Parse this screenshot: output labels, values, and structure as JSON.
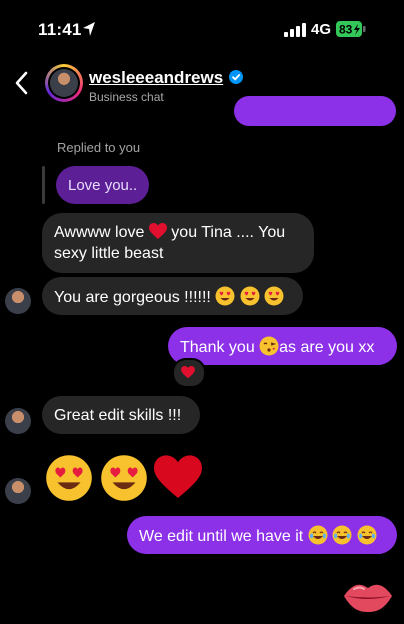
{
  "status": {
    "time": "11:41",
    "network": "4G",
    "battery": "83"
  },
  "header": {
    "username": "wesleeeandrews",
    "subtitle": "Business chat"
  },
  "replied_label": "Replied to you",
  "messages": {
    "reply_quote": "Love you..",
    "m1_a": "Awwww love ",
    "m1_b": " you Tina .... You sexy little beast",
    "m2": "You are gorgeous !!!!!! ",
    "m3_a": "Thank you ",
    "m3_b": "as are you xx",
    "m4": "Great edit skills !!!",
    "m6": "We edit until we have it "
  },
  "colors": {
    "outgoing": "#8d31e8",
    "incoming": "#262626",
    "reply_quote": "#5c1f95"
  },
  "icons": {
    "location": "location-arrow-icon",
    "back": "chevron-left-icon",
    "verified": "verified-badge-icon",
    "heart": "red-heart-icon",
    "heart_eyes": "heart-eyes-emoji",
    "kiss": "face-blowing-kiss-emoji",
    "laugh": "tears-of-joy-emoji",
    "lips": "lips-icon"
  }
}
